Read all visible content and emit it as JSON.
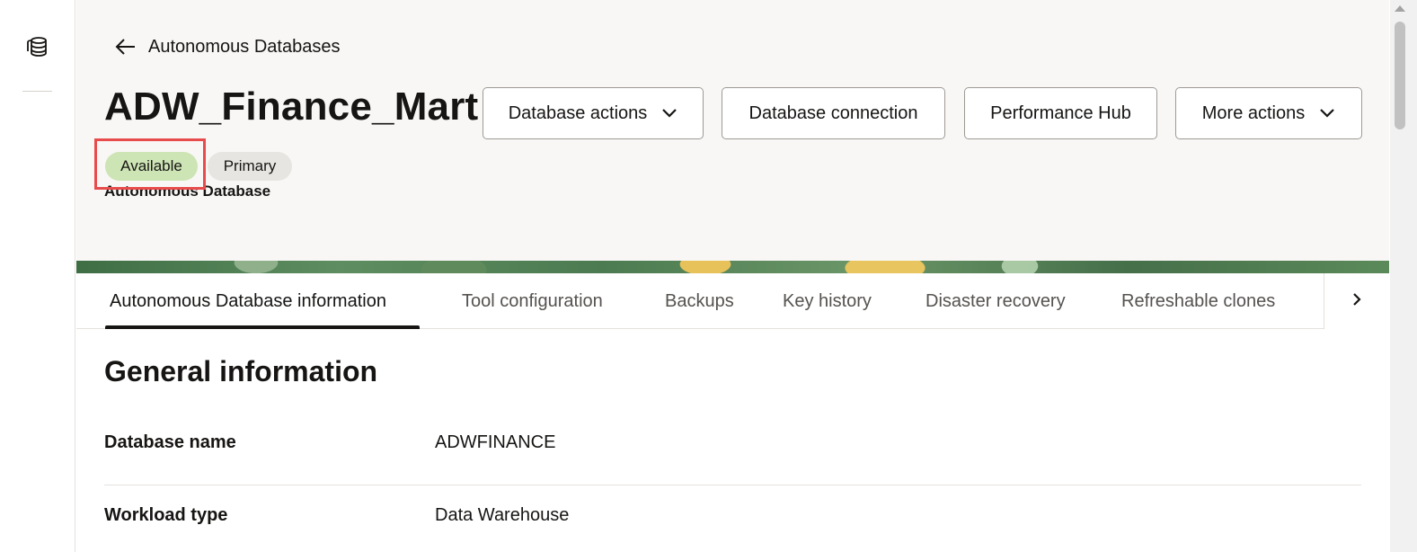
{
  "header": {
    "back_label": "Autonomous Databases",
    "title": "ADW_Finance_Mart",
    "status_badge": "Available",
    "role_badge": "Primary",
    "subtitle": "Autonomous Database",
    "buttons": {
      "database_actions": "Database actions",
      "database_connection": "Database connection",
      "performance_hub": "Performance Hub",
      "more_actions": "More actions"
    }
  },
  "tabs": [
    {
      "label": "Autonomous Database information",
      "active": true
    },
    {
      "label": "Tool configuration"
    },
    {
      "label": "Backups"
    },
    {
      "label": "Key history"
    },
    {
      "label": "Disaster recovery"
    },
    {
      "label": "Refreshable clones"
    }
  ],
  "general_information": {
    "title": "General information",
    "rows": [
      {
        "label": "Database name",
        "value": "ADWFINANCE"
      },
      {
        "label": "Workload type",
        "value": "Data Warehouse"
      }
    ]
  },
  "icons": {
    "rail": "database-icon",
    "back": "arrow-left-icon",
    "dropdown": "chevron-down-icon",
    "tabs_next": "chevron-right-icon"
  },
  "colors": {
    "available_badge": "#cde4b5",
    "highlight": "#e84b4b",
    "text": "#161513"
  }
}
